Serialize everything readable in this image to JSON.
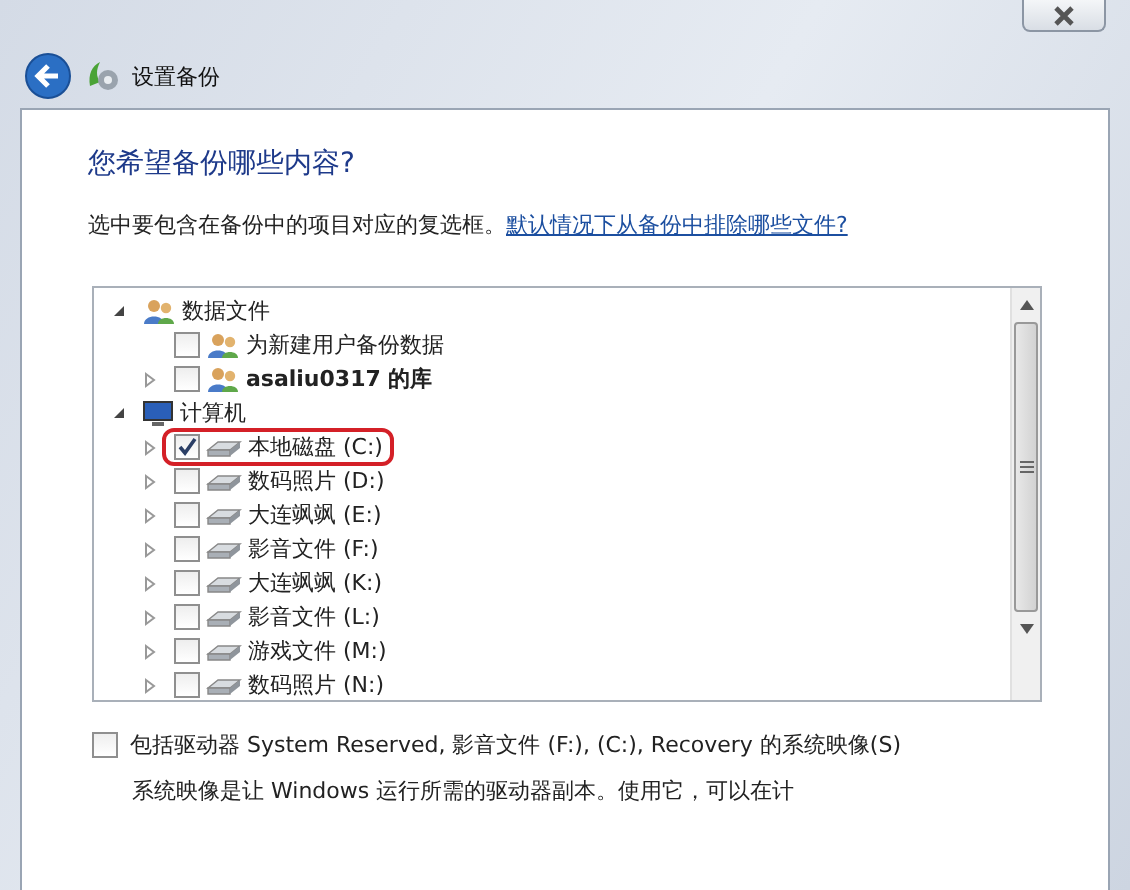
{
  "window": {
    "title": "设置备份"
  },
  "heading": "您希望备份哪些内容?",
  "instruction": {
    "text": "选中要包含在备份中的项目对应的复选框。",
    "link": "默认情况下从备份中排除哪些文件?"
  },
  "tree": [
    {
      "label": "数据文件",
      "kind": "users",
      "expanded": true,
      "children": [
        {
          "label": "为新建用户备份数据",
          "kind": "users",
          "checked": false
        },
        {
          "label": "asaliu0317 的库",
          "kind": "users",
          "checked": false,
          "expanded": false,
          "emphasized": true
        }
      ]
    },
    {
      "label": "计算机",
      "kind": "computer",
      "expanded": true,
      "children": [
        {
          "label": "本地磁盘 (C:)",
          "kind": "drive",
          "checked": true,
          "expanded": false,
          "highlighted": true
        },
        {
          "label": "数码照片 (D:)",
          "kind": "drive",
          "checked": false,
          "expanded": false
        },
        {
          "label": "大连飒飒 (E:)",
          "kind": "drive",
          "checked": false,
          "expanded": false
        },
        {
          "label": "影音文件 (F:)",
          "kind": "drive",
          "checked": false,
          "expanded": false
        },
        {
          "label": "大连飒飒 (K:)",
          "kind": "drive",
          "checked": false,
          "expanded": false
        },
        {
          "label": "影音文件 (L:)",
          "kind": "drive",
          "checked": false,
          "expanded": false
        },
        {
          "label": "游戏文件 (M:)",
          "kind": "drive",
          "checked": false,
          "expanded": false
        },
        {
          "label": "数码照片 (N:)",
          "kind": "drive",
          "checked": false,
          "expanded": false
        }
      ]
    }
  ],
  "system_image": {
    "label": "包括驱动器 System Reserved, 影音文件 (F:), (C:), Recovery 的系统映像(S)",
    "checked": false,
    "description": "系统映像是让 Windows 运行所需的驱动器副本。使用它，可以在计"
  }
}
